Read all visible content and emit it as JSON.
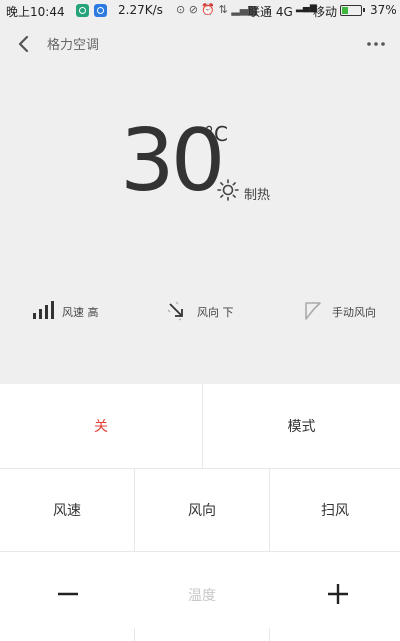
{
  "status_bar": {
    "time": "晚上10:44",
    "net_speed": "2.27K/s",
    "carrier1": "联通 4G",
    "carrier2": "移动",
    "battery": "37%",
    "battery_level": 0.37,
    "battery_color": "#3fb63f"
  },
  "nav": {
    "title": "格力空调"
  },
  "display": {
    "temperature": "30",
    "unit": "°C",
    "mode": "制热"
  },
  "stats": {
    "fan_speed": "风速 高",
    "fan_direction": "风向 下",
    "manual_direction": "手动风向"
  },
  "controls": {
    "off": "关",
    "mode": "模式",
    "fan_speed": "风速",
    "direction": "风向",
    "swing": "扫风",
    "temperature": "温度"
  },
  "colors": {
    "off_accent": "#e5413a",
    "background": "#efefef",
    "panel": "#ffffff"
  }
}
